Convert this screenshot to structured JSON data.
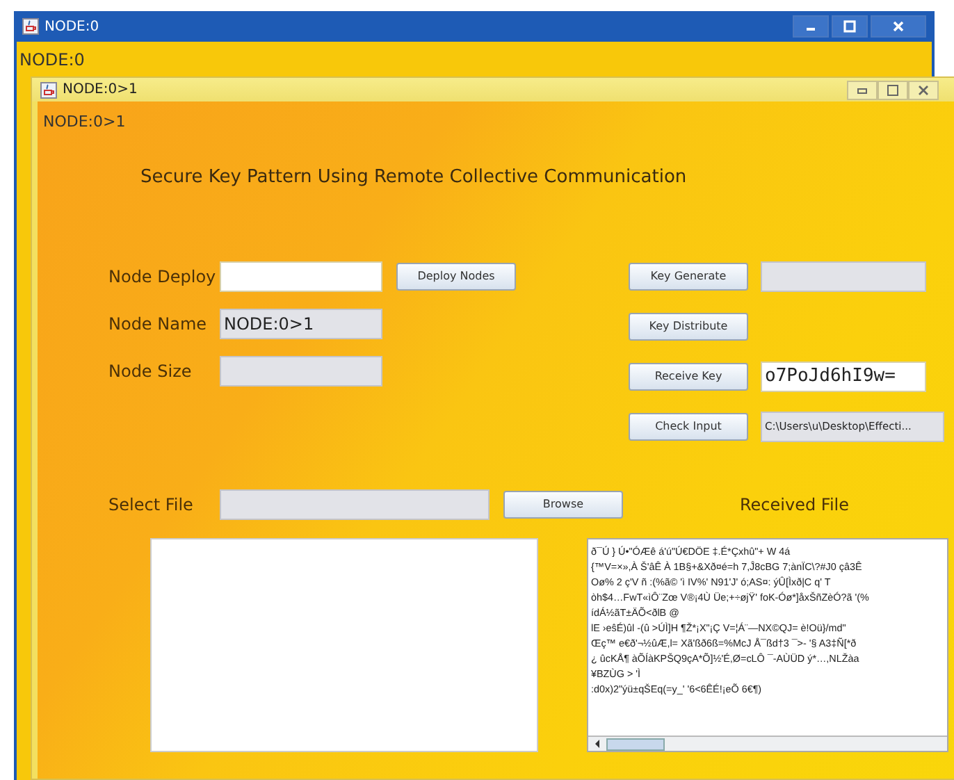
{
  "outer_window": {
    "title": "NODE:0",
    "label": "NODE:0"
  },
  "inner_window": {
    "title": "NODE:0>1",
    "label": "NODE:0>1"
  },
  "heading": "Secure Key Pattern Using Remote Collective Communication",
  "form_rows": [
    {
      "label": "Node Deploy",
      "field": {
        "disabled": false
      },
      "button": "Deploy Nodes"
    },
    {
      "label": "Node Name",
      "field": {
        "value": "NODE:0>1",
        "disabled": true
      }
    },
    {
      "label": "Node Size",
      "field": {
        "disabled": true
      }
    }
  ],
  "key_actions": [
    {
      "button": "Key Generate",
      "field": {
        "disabled": true
      }
    },
    {
      "button": "Key Distribute"
    },
    {
      "button": "Receive Key",
      "field": {
        "value": "o7PoJd6hI9w=",
        "disabled": false
      }
    },
    {
      "button": "Check Input",
      "field": {
        "value": "C:\\Users\\u\\Desktop\\Effecti...",
        "disabled": true
      }
    }
  ],
  "select_file": {
    "label": "Select File",
    "field": {
      "disabled": true
    },
    "button": "Browse"
  },
  "received_file": {
    "label": "Received File",
    "lines": [
      "ð¯Ú } Ú•\"ÓÆê á'ú\"Ú€DÖE ‡.É*Çxhû\"+ W 4á",
      "{™V=×»,À Š'âÊ À 1B§+&Xð¤é=h 7,Ĵ8cBG 7;ànÏC\\?#J0 çâ3Ê",
      "Oø% 2 ç'V ñ :(%ã© 'ì IV%' N91'J' ó;AS¤: ýÛ[Ìxð|C q' T",
      "òh$4…FwT«ìÔ¨Zœ V®¡4Ù Üe;+÷øjŸ' foK-Óø*]åxŠñZèÓ?ã '(%",
      "ídÁ½ãT±ÄÕ<ðlB @",
      "lE ›eŝÉ)ûl -(û >ÚÌ]H ¶Ž*¡X\"¡Ç V=¦Á¨—NX©QJ= è!Oü}/md\"",
      "Œç™ e€ð'¬½ûÆ,l= Xã'ßð6ß=%McJ Å¯ßd†3 ¯>- '§ A3‡Ñ[*ð",
      " ¿ ûcKÅ¶ àÕÍàKPŠQ9çA*Õ]½'É,Ø=cLÔ ¯-AÙÜD ý*…,NLŽàa",
      "¥BZÙG > 'Ì",
      ":d0x)2\"ýü±qŠEq(=y_' '6<6ÊÉ!¡eÕ 6€¶)"
    ]
  }
}
